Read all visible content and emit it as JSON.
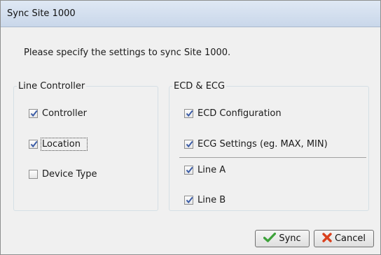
{
  "window": {
    "title": "Sync Site 1000"
  },
  "dialog": {
    "prompt": "Please specify the settings to sync Site 1000."
  },
  "line_controller": {
    "legend": "Line Controller",
    "options": [
      {
        "label": "Controller",
        "checked": true
      },
      {
        "label": "Location",
        "checked": true,
        "focused": true
      },
      {
        "label": "Device Type",
        "checked": false
      }
    ]
  },
  "ecd_ecg": {
    "legend": "ECD & ECG",
    "options": [
      {
        "label": "ECD Configuration",
        "checked": true
      },
      {
        "label": "ECG Settings (eg. MAX, MIN)",
        "checked": true
      },
      {
        "label": "Line A",
        "checked": true
      },
      {
        "label": "Line B",
        "checked": true
      }
    ]
  },
  "buttons": {
    "sync_label": "Sync",
    "sync_icon": "checkmark-icon",
    "cancel_label": "Cancel",
    "cancel_icon": "red-x-icon"
  },
  "colors": {
    "check_accent": "#3a5ba6",
    "sync_icon": "#3da23a",
    "cancel_icon": "#d9401d"
  }
}
